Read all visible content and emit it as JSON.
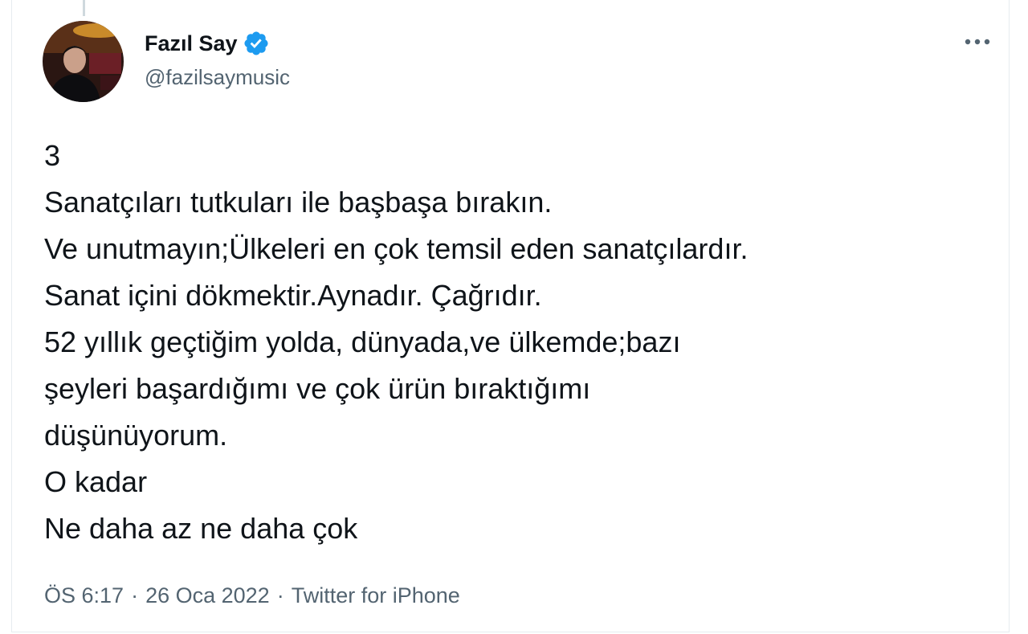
{
  "tweet": {
    "author": {
      "display_name": "Fazıl Say",
      "handle": "@fazilsaymusic",
      "verified": true,
      "avatar_icon": "profile-photo"
    },
    "text_lines": [
      "3",
      "Sanatçıları tutkuları ile başbaşa bırakın.",
      "Ve unutmayın;Ülkeleri en çok temsil eden sanatçılardır.",
      "Sanat içini dökmektir.Aynadır. Çağrıdır.",
      "52 yıllık geçtiğim yolda, dünyada,ve ülkemde;bazı",
      "şeyleri başardığımı ve çok ürün bıraktığımı",
      "düşünüyorum.",
      "O kadar",
      "Ne daha az ne daha çok"
    ],
    "meta": {
      "time": "ÖS 6:17",
      "separator": "·",
      "date": "26 Oca 2022",
      "source": "Twitter for iPhone"
    },
    "more_icon": "more-horizontal-icon"
  },
  "colors": {
    "text_primary": "#0f1419",
    "text_secondary": "#536471",
    "verified_blue": "#1d9bf0",
    "border": "#e6ecf0"
  }
}
